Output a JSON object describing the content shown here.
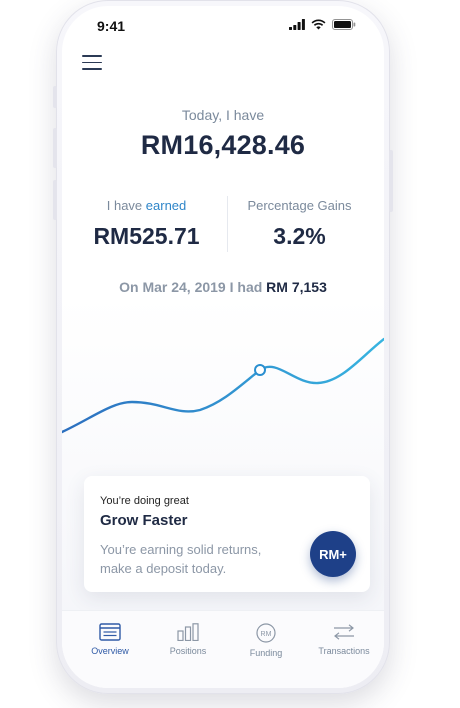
{
  "status_bar": {
    "time": "9:41"
  },
  "header": {
    "caption": "Today, I have",
    "balance": "RM16,428.46"
  },
  "stats": {
    "earned_label_prefix": "I have",
    "earned_label_accent": "earned",
    "earned_value": "RM525.71",
    "gains_label": "Percentage Gains",
    "gains_value": "3.2%"
  },
  "history": {
    "prefix": "On Mar 24, 2019 I had",
    "amount": "RM 7,153"
  },
  "card": {
    "eyebrow": "You’re doing great",
    "title": "Grow Faster",
    "body": "You’re earning solid returns, make a deposit today.",
    "button_label": "RM+"
  },
  "tabs": [
    {
      "label": "Overview",
      "icon": "overview-icon",
      "active": true
    },
    {
      "label": "Positions",
      "icon": "bar-chart-icon",
      "active": false
    },
    {
      "label": "Funding",
      "icon": "rm-coin-icon",
      "active": false
    },
    {
      "label": "Transactions",
      "icon": "transfer-arrows-icon",
      "active": false
    }
  ],
  "colors": {
    "accent": "#2f86c9",
    "primary": "#1e4088",
    "text_dark": "#1f2a44",
    "text_muted": "#7b8a9c"
  }
}
